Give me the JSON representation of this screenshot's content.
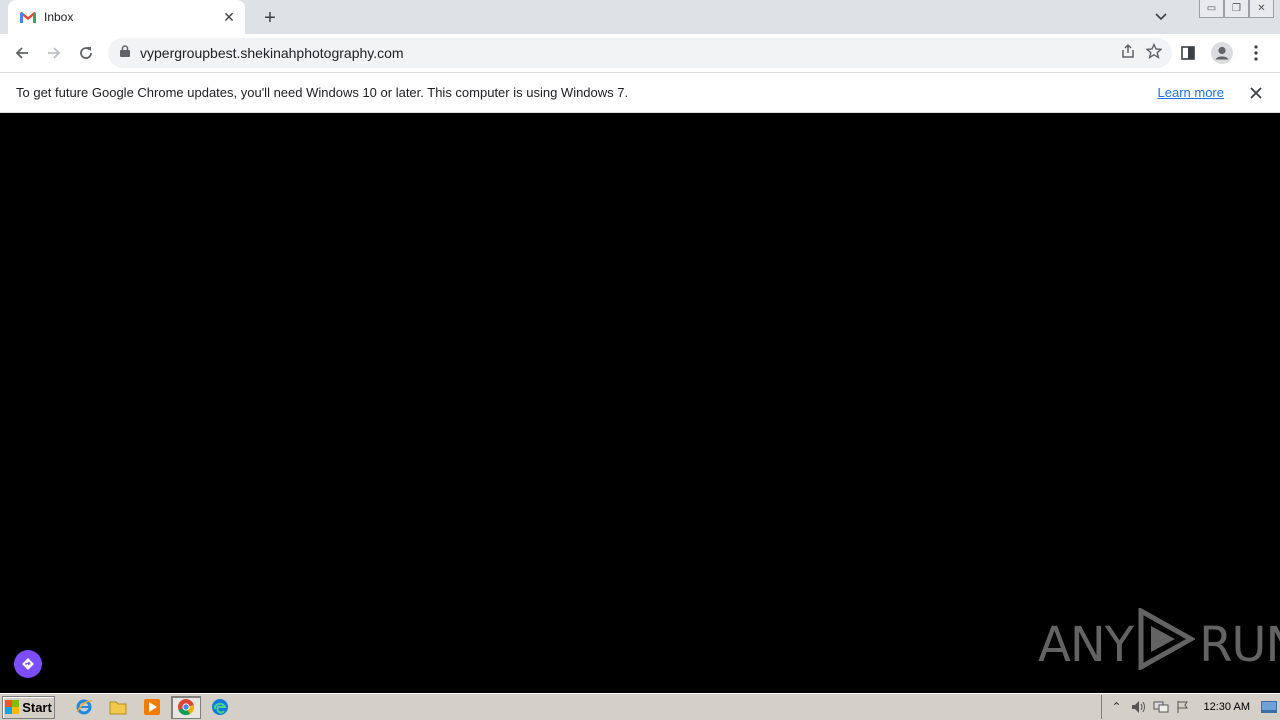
{
  "tab": {
    "title": "Inbox",
    "favicon": "gmail-icon"
  },
  "omnibox": {
    "url": "vypergroupbest.shekinahphotography.com"
  },
  "infobar": {
    "message": "To get future Google Chrome updates, you'll need Windows 10 or later. This computer is using Windows 7.",
    "link": "Learn more"
  },
  "watermark": {
    "left": "ANY",
    "right": "RUN"
  },
  "taskbar": {
    "start_label": "Start",
    "clock": "12:30 AM"
  },
  "colors": {
    "accent": "#7c4dff",
    "link": "#1a73e8",
    "taskbar": "#d4d0c8"
  }
}
